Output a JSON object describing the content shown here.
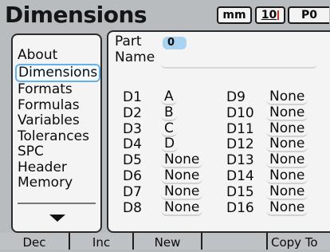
{
  "header": {
    "title": "Dimensions",
    "unit": "mm",
    "datum": "10",
    "preset": "P0"
  },
  "menu": {
    "items": [
      "About",
      "Dimensions",
      "Formats",
      "Formulas",
      "Variables",
      "Tolerances",
      "SPC",
      "Header",
      "Memory"
    ],
    "selected": "Dimensions",
    "scroll_icon": "triangle-down-icon"
  },
  "panel": {
    "part_label": "Part",
    "part_value": "0",
    "name_label": "Name",
    "name_value": "",
    "dimensions_left": [
      {
        "label": "D1",
        "value": "A"
      },
      {
        "label": "D2",
        "value": "B"
      },
      {
        "label": "D3",
        "value": "C"
      },
      {
        "label": "D4",
        "value": "D"
      },
      {
        "label": "D5",
        "value": "None"
      },
      {
        "label": "D6",
        "value": "None"
      },
      {
        "label": "D7",
        "value": "None"
      },
      {
        "label": "D8",
        "value": "None"
      }
    ],
    "dimensions_right": [
      {
        "label": "D9",
        "value": "None"
      },
      {
        "label": "D10",
        "value": "None"
      },
      {
        "label": "D11",
        "value": "None"
      },
      {
        "label": "D12",
        "value": "None"
      },
      {
        "label": "D13",
        "value": "None"
      },
      {
        "label": "D14",
        "value": "None"
      },
      {
        "label": "D15",
        "value": "None"
      },
      {
        "label": "D16",
        "value": "None"
      }
    ]
  },
  "softkeys": [
    "Dec",
    "Inc",
    "New",
    "",
    "Copy To"
  ],
  "colors": {
    "background": "#b9bcbf",
    "panel": "#f4f4f4",
    "highlight": "#6ab0e8",
    "badge": "#a9d3ef",
    "datum_tick": "#c0392b"
  }
}
